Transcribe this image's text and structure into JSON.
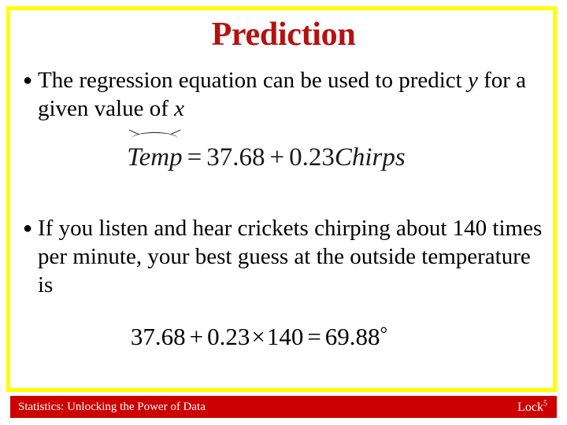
{
  "slide": {
    "title": "Prediction",
    "title_color": "#b51111",
    "border_color": "#ffff00",
    "background_color": "#ffffff"
  },
  "bullets": [
    {
      "marker": "bullet-dot",
      "text_part1": "The regression equation can be used to predict ",
      "italic1": "y",
      "text_part2": " for a given value of ",
      "italic2": "x",
      "text_part3": ""
    },
    {
      "marker": "bullet-dot",
      "text_part1": "If you listen and hear crickets chirping about 140 times per minute, your best guess at the outside temperature is",
      "italic1": "",
      "text_part2": "",
      "italic2": "",
      "text_part3": ""
    }
  ],
  "equations": {
    "eq1": {
      "hatted_variable": "Temp",
      "equals": "=",
      "intercept": "37.68",
      "plus": "+",
      "slope": "0.23",
      "predictor": "Chirps",
      "plain_text": "Temp̂ = 37.68 + 0.23Chirps"
    },
    "eq2": {
      "intercept": "37.68",
      "plus": "+",
      "slope": "0.23",
      "times": "×",
      "chirps_value": "140",
      "equals": "=",
      "result": "69.88",
      "degree": "°",
      "plain_text": "37.68 + 0.23×140 = 69.88°"
    }
  },
  "footer": {
    "left_text": "Statistics: Unlocking the Power of Data",
    "right_text": "Lock",
    "right_superscript": "5",
    "bar_color": "#cc0000",
    "text_color": "#ffffff"
  }
}
